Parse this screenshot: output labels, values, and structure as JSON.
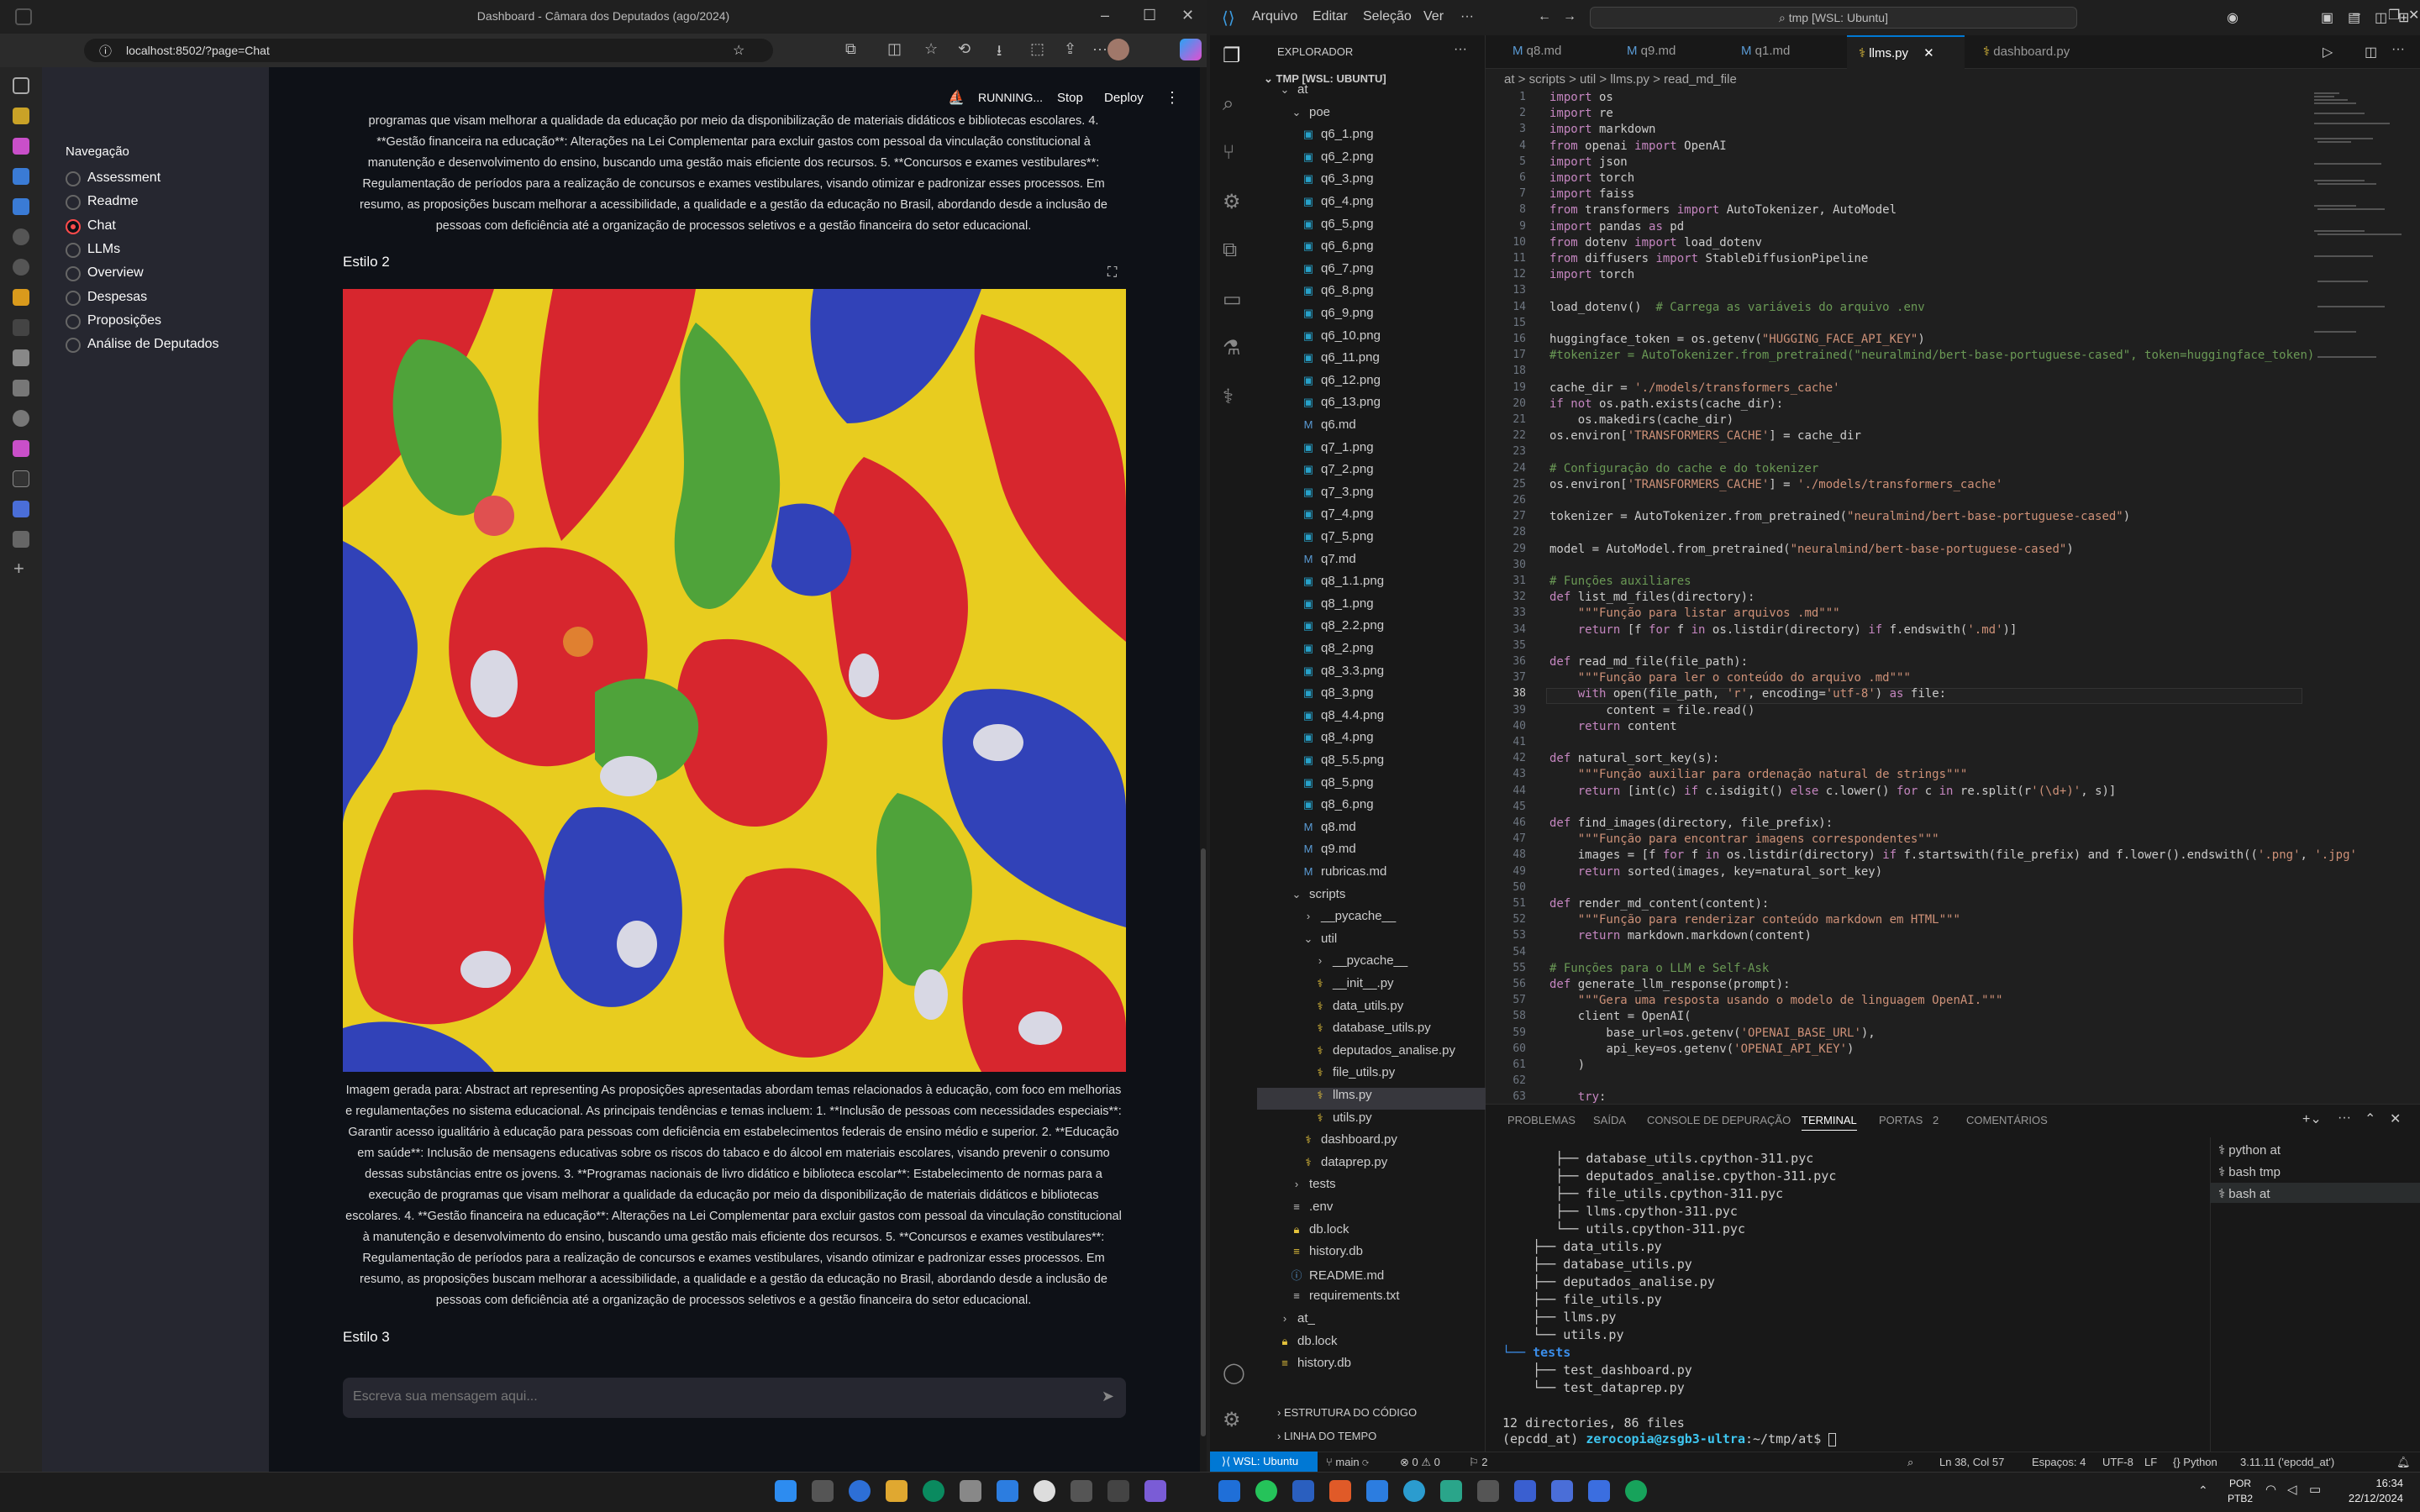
{
  "browser": {
    "title": "Dashboard - Câmara dos Deputados (ago/2024)",
    "url": "localhost:8502/?page=Chat"
  },
  "streamlit": {
    "nav_title": "Navegação",
    "nav_items": [
      "Assessment",
      "Readme",
      "Chat",
      "LLMs",
      "Overview",
      "Despesas",
      "Proposições",
      "Análise de Deputados"
    ],
    "selected": "Chat",
    "status": "RUNNING...",
    "stop": "Stop",
    "deploy": "Deploy",
    "text_top": "programas que visam melhorar a qualidade da educação por meio da disponibilização de materiais didáticos e bibliotecas escolares. 4. **Gestão financeira na educação**: Alterações na Lei Complementar para excluir gastos com pessoal da vinculação constitucional à manutenção e desenvolvimento do ensino, buscando uma gestão mais eficiente dos recursos. 5. **Concursos e exames vestibulares**: Regulamentação de períodos para a realização de concursos e exames vestibulares, visando otimizar e padronizar esses processos. Em resumo, as proposições buscam melhorar a acessibilidade, a qualidade e a gestão da educação no Brasil, abordando desde a inclusão de pessoas com deficiência até a organização de processos seletivos e a gestão financeira do setor educacional.",
    "estilo2": "Estilo 2",
    "caption": "Imagem gerada para: Abstract art representing As proposições apresentadas abordam temas relacionados à educação, com foco em melhorias e regulamentações no sistema educacional. As principais tendências e temas incluem: 1. **Inclusão de pessoas com necessidades especiais**: Garantir acesso igualitário à educação para pessoas com deficiência em estabelecimentos federais de ensino médio e superior. 2. **Educação em saúde**: Inclusão de mensagens educativas sobre os riscos do tabaco e do álcool em materiais escolares, visando prevenir o consumo dessas substâncias entre os jovens. 3. **Programas nacionais de livro didático e biblioteca escolar**: Estabelecimento de normas para a execução de programas que visam melhorar a qualidade da educação por meio da disponibilização de materiais didáticos e bibliotecas escolares. 4. **Gestão financeira na educação**: Alterações na Lei Complementar para excluir gastos com pessoal da vinculação constitucional à manutenção e desenvolvimento do ensino, buscando uma gestão mais eficiente dos recursos. 5. **Concursos e exames vestibulares**: Regulamentação de períodos para a realização de concursos e exames vestibulares, visando otimizar e padronizar esses processos. Em resumo, as proposições buscam melhorar a acessibilidade, a qualidade e a gestão da educação no Brasil, abordando desde a inclusão de pessoas com deficiência até a organização de processos seletivos e a gestão financeira do setor educacional.",
    "estilo3": "Estilo 3",
    "chat_placeholder": "Escreva sua mensagem aqui..."
  },
  "vscode": {
    "menu": [
      "Arquivo",
      "Editar",
      "Seleção",
      "Ver",
      "···"
    ],
    "search": "tmp [WSL: Ubuntu]",
    "explorer_title": "EXPLORADOR",
    "workspace": "TMP [WSL: UBUNTU]",
    "tabs": [
      "q8.md",
      "q9.md",
      "q1.md",
      "llms.py",
      "dashboard.py"
    ],
    "active_tab": "llms.py",
    "breadcrumb": "at > scripts > util > llms.py > read_md_file",
    "tree": [
      {
        "d": 1,
        "t": "f",
        "n": "at"
      },
      {
        "d": 2,
        "t": "f",
        "n": "poe"
      },
      {
        "d": 3,
        "t": "i",
        "n": "q6_1.png"
      },
      {
        "d": 3,
        "t": "i",
        "n": "q6_2.png"
      },
      {
        "d": 3,
        "t": "i",
        "n": "q6_3.png"
      },
      {
        "d": 3,
        "t": "i",
        "n": "q6_4.png"
      },
      {
        "d": 3,
        "t": "i",
        "n": "q6_5.png"
      },
      {
        "d": 3,
        "t": "i",
        "n": "q6_6.png"
      },
      {
        "d": 3,
        "t": "i",
        "n": "q6_7.png"
      },
      {
        "d": 3,
        "t": "i",
        "n": "q6_8.png"
      },
      {
        "d": 3,
        "t": "i",
        "n": "q6_9.png"
      },
      {
        "d": 3,
        "t": "i",
        "n": "q6_10.png"
      },
      {
        "d": 3,
        "t": "i",
        "n": "q6_11.png"
      },
      {
        "d": 3,
        "t": "i",
        "n": "q6_12.png"
      },
      {
        "d": 3,
        "t": "i",
        "n": "q6_13.png"
      },
      {
        "d": 3,
        "t": "m",
        "n": "q6.md"
      },
      {
        "d": 3,
        "t": "i",
        "n": "q7_1.png"
      },
      {
        "d": 3,
        "t": "i",
        "n": "q7_2.png"
      },
      {
        "d": 3,
        "t": "i",
        "n": "q7_3.png"
      },
      {
        "d": 3,
        "t": "i",
        "n": "q7_4.png"
      },
      {
        "d": 3,
        "t": "i",
        "n": "q7_5.png"
      },
      {
        "d": 3,
        "t": "m",
        "n": "q7.md"
      },
      {
        "d": 3,
        "t": "i",
        "n": "q8_1.1.png"
      },
      {
        "d": 3,
        "t": "i",
        "n": "q8_1.png"
      },
      {
        "d": 3,
        "t": "i",
        "n": "q8_2.2.png"
      },
      {
        "d": 3,
        "t": "i",
        "n": "q8_2.png"
      },
      {
        "d": 3,
        "t": "i",
        "n": "q8_3.3.png"
      },
      {
        "d": 3,
        "t": "i",
        "n": "q8_3.png"
      },
      {
        "d": 3,
        "t": "i",
        "n": "q8_4.4.png"
      },
      {
        "d": 3,
        "t": "i",
        "n": "q8_4.png"
      },
      {
        "d": 3,
        "t": "i",
        "n": "q8_5.5.png"
      },
      {
        "d": 3,
        "t": "i",
        "n": "q8_5.png"
      },
      {
        "d": 3,
        "t": "i",
        "n": "q8_6.png"
      },
      {
        "d": 3,
        "t": "m",
        "n": "q8.md"
      },
      {
        "d": 3,
        "t": "m",
        "n": "q9.md"
      },
      {
        "d": 3,
        "t": "m",
        "n": "rubricas.md"
      },
      {
        "d": 2,
        "t": "f",
        "n": "scripts"
      },
      {
        "d": 3,
        "t": "c",
        "n": "__pycache__"
      },
      {
        "d": 3,
        "t": "f",
        "n": "util"
      },
      {
        "d": 4,
        "t": "c",
        "n": "__pycache__"
      },
      {
        "d": 4,
        "t": "p",
        "n": "__init__.py"
      },
      {
        "d": 4,
        "t": "p",
        "n": "data_utils.py"
      },
      {
        "d": 4,
        "t": "p",
        "n": "database_utils.py"
      },
      {
        "d": 4,
        "t": "p",
        "n": "deputados_analise.py"
      },
      {
        "d": 4,
        "t": "p",
        "n": "file_utils.py"
      },
      {
        "d": 4,
        "t": "p",
        "n": "llms.py",
        "sel": true
      },
      {
        "d": 4,
        "t": "p",
        "n": "utils.py"
      },
      {
        "d": 3,
        "t": "p",
        "n": "dashboard.py"
      },
      {
        "d": 3,
        "t": "p",
        "n": "dataprep.py"
      },
      {
        "d": 2,
        "t": "c",
        "n": "tests"
      },
      {
        "d": 2,
        "t": "e",
        "n": ".env"
      },
      {
        "d": 2,
        "t": "k",
        "n": "db.lock"
      },
      {
        "d": 2,
        "t": "b",
        "n": "history.db"
      },
      {
        "d": 2,
        "t": "r",
        "n": "README.md"
      },
      {
        "d": 2,
        "t": "e",
        "n": "requirements.txt"
      },
      {
        "d": 1,
        "t": "c",
        "n": "at_"
      },
      {
        "d": 1,
        "t": "k",
        "n": "db.lock"
      },
      {
        "d": 1,
        "t": "b",
        "n": "history.db"
      }
    ],
    "outline": "ESTRUTURA DO CÓDIGO",
    "timeline": "LINHA DO TEMPO",
    "code": [
      "import os",
      "import re",
      "import markdown",
      "from openai import OpenAI",
      "import json",
      "import torch",
      "import faiss",
      "from transformers import AutoTokenizer, AutoModel",
      "import pandas as pd",
      "from dotenv import load_dotenv",
      "from diffusers import StableDiffusionPipeline",
      "import torch",
      "",
      "load_dotenv()  # Carrega as variáveis do arquivo .env",
      "",
      "huggingface_token = os.getenv(\"HUGGING_FACE_API_KEY\")",
      "#tokenizer = AutoTokenizer.from_pretrained(\"neuralmind/bert-base-portuguese-cased\", token=huggingface_token)",
      "",
      "cache_dir = './models/transformers_cache'",
      "if not os.path.exists(cache_dir):",
      "    os.makedirs(cache_dir)",
      "os.environ['TRANSFORMERS_CACHE'] = cache_dir",
      "",
      "# Configuração do cache e do tokenizer",
      "os.environ['TRANSFORMERS_CACHE'] = './models/transformers_cache'",
      "",
      "tokenizer = AutoTokenizer.from_pretrained(\"neuralmind/bert-base-portuguese-cased\")",
      "",
      "model = AutoModel.from_pretrained(\"neuralmind/bert-base-portuguese-cased\")",
      "",
      "# Funções auxiliares",
      "def list_md_files(directory):",
      "    \"\"\"Função para listar arquivos .md\"\"\"",
      "    return [f for f in os.listdir(directory) if f.endswith('.md')]",
      "",
      "def read_md_file(file_path):",
      "    \"\"\"Função para ler o conteúdo do arquivo .md\"\"\"",
      "    with open(file_path, 'r', encoding='utf-8') as file:",
      "        content = file.read()",
      "    return content",
      "",
      "def natural_sort_key(s):",
      "    \"\"\"Função auxiliar para ordenação natural de strings\"\"\"",
      "    return [int(c) if c.isdigit() else c.lower() for c in re.split(r'(\\d+)', s)]",
      "",
      "def find_images(directory, file_prefix):",
      "    \"\"\"Função para encontrar imagens correspondentes\"\"\"",
      "    images = [f for f in os.listdir(directory) if f.startswith(file_prefix) and f.lower().endswith(('.png', '.jpg'",
      "    return sorted(images, key=natural_sort_key)",
      "",
      "def render_md_content(content):",
      "    \"\"\"Função para renderizar conteúdo markdown em HTML\"\"\"",
      "    return markdown.markdown(content)",
      "",
      "# Funções para o LLM e Self-Ask",
      "def generate_llm_response(prompt):",
      "    \"\"\"Gera uma resposta usando o modelo de linguagem OpenAI.\"\"\"",
      "    client = OpenAI(",
      "        base_url=os.getenv('OPENAI_BASE_URL'),",
      "        api_key=os.getenv('OPENAI_API_KEY')",
      "    )",
      "",
      "    try:"
    ],
    "panel_tabs": [
      "PROBLEMAS",
      "SAÍDA",
      "CONSOLE DE DEPURAÇÃO",
      "TERMINAL",
      "PORTAS",
      "2",
      "COMENTÁRIOS"
    ],
    "terminal": [
      "       ├── database_utils.cpython-311.pyc",
      "       ├── deputados_analise.cpython-311.pyc",
      "       ├── file_utils.cpython-311.pyc",
      "       ├── llms.cpython-311.pyc",
      "       └── utils.cpython-311.pyc",
      "    ├── data_utils.py",
      "    ├── database_utils.py",
      "    ├── deputados_analise.py",
      "    ├── file_utils.py",
      "    ├── llms.py",
      "    └── utils.py",
      "└── tests",
      "    ├── test_dashboard.py",
      "    └── test_dataprep.py",
      "",
      "12 directories, 86 files"
    ],
    "prompt_env": "(epcdd_at) ",
    "prompt_user": "zerocopia@zsgb3-ultra",
    "prompt_path": ":~/tmp/at$ ",
    "terminals": [
      "python at",
      "bash tmp",
      "bash at"
    ],
    "status": {
      "remote": "WSL: Ubuntu",
      "branch": "main",
      "errors": "⊗ 0 ⚠ 0",
      "ports": "2",
      "pos": "Ln 38, Col 57",
      "spaces": "Espaços: 4",
      "enc": "UTF-8",
      "eol": "LF",
      "lang": "Python",
      "interp": "3.11.11 ('epcdd_at')"
    }
  },
  "taskbar": {
    "lang1": "POR",
    "lang2": "PTB2",
    "time": "16:34",
    "date": "22/12/2024"
  },
  "colors": {
    "accent": "#0078d4",
    "streamlit_red": "#ff4b4b"
  }
}
